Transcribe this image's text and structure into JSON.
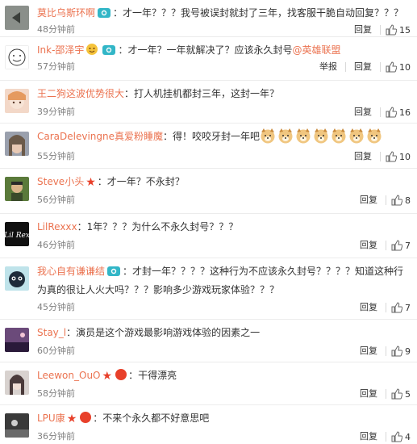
{
  "comments": [
    {
      "user": "莫比乌斯环啊",
      "text": "：才一年？？？我号被误封就封了三年，找客服干脆自动回复？？？",
      "time": "48分钟前",
      "actions": [
        "回复"
      ],
      "likes": "15"
    },
    {
      "user": "Ink-邵泽宇",
      "text": "：才一年？一年就解决了？应该永久封号",
      "mention": "@英雄联盟",
      "time": "57分钟前",
      "actions": [
        "举报",
        "回复"
      ],
      "likes": "10"
    },
    {
      "user": "王二狗这波优势很大",
      "text": "：打人机挂机都封三年，这封一年？",
      "time": "39分钟前",
      "actions": [
        "回复"
      ],
      "likes": "16"
    },
    {
      "user": "CaraDelevingne真爱粉睡魔",
      "text": "：得！咬咬牙封一年吧",
      "time": "55分钟前",
      "actions": [
        "回复"
      ],
      "likes": "10"
    },
    {
      "user": "Steve小头",
      "text": "：才一年？不永封？",
      "time": "56分钟前",
      "actions": [
        "回复"
      ],
      "likes": "8"
    },
    {
      "user": "LilRexxx",
      "text": "：1年？？？为什么不永久封号？？？",
      "time": "46分钟前",
      "actions": [
        "回复"
      ],
      "likes": "7"
    },
    {
      "user": "我心自有谦谦结",
      "text": "：才封一年？？？？这种行为不应该永久封号？？？？知道这种行为真的很让人火大吗？？？影响多少游戏玩家体验？？？",
      "time": "45分钟前",
      "actions": [
        "回复"
      ],
      "likes": "7"
    },
    {
      "user": "Stay_l",
      "text": "：演员是这个游戏最影响游戏体验的因素之一",
      "time": "60分钟前",
      "actions": [
        "回复"
      ],
      "likes": "9"
    },
    {
      "user": "Leewon_OuO",
      "text": "：干得漂亮",
      "time": "58分钟前",
      "actions": [
        "回复"
      ],
      "likes": "5"
    },
    {
      "user": "LPU康",
      "text": "：不来个永久都不好意思吧",
      "time": "36分钟前",
      "actions": [
        "回复"
      ],
      "likes": "4"
    }
  ],
  "colors": {
    "username": "#eb7350",
    "text": "#333333",
    "meta": "#808080"
  }
}
